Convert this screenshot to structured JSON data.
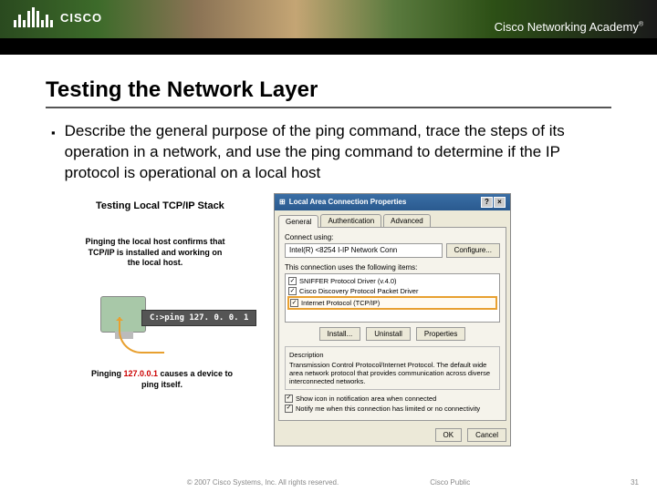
{
  "banner": {
    "brand": "CISCO",
    "academy": "Cisco Networking Academy"
  },
  "slide": {
    "title": "Testing the Network Layer",
    "bullet": "Describe the general purpose of the ping command, trace the steps of its operation in a network, and use the ping command to determine if the IP protocol is operational on a local host"
  },
  "diag": {
    "subtitle": "Testing Local TCP/IP Stack",
    "info1": "Pinging the local host confirms that TCP/IP is installed and working on the local host.",
    "cmd": "C:>ping 127. 0. 0. 1",
    "info2_pre": "Pinging ",
    "info2_ip": "127.0.0.1",
    "info2_post": " causes a device to ping itself."
  },
  "dialog": {
    "title": "Local Area Connection Properties",
    "tabs": {
      "general": "General",
      "auth": "Authentication",
      "adv": "Advanced"
    },
    "connect_lbl": "Connect using:",
    "adapter": "Intel(R) <8254 I-IP Network Conn",
    "configure": "Configure...",
    "uses_lbl": "This connection uses the following items:",
    "items": [
      "SNIFFER Protocol Driver (v.4.0)",
      "Cisco Discovery Protocol Packet Driver",
      "Internet Protocol (TCP/IP)"
    ],
    "install": "Install...",
    "uninstall": "Uninstall",
    "properties": "Properties",
    "desc_title": "Description",
    "desc": "Transmission Control Protocol/Internet Protocol. The default wide area network protocol that provides communication across diverse interconnected networks.",
    "opt1": "Show icon in notification area when connected",
    "opt2": "Notify me when this connection has limited or no connectivity",
    "ok": "OK",
    "cancel": "Cancel"
  },
  "footer": {
    "copyright": "© 2007 Cisco Systems, Inc. All rights reserved.",
    "label": "Cisco Public",
    "page": "31"
  }
}
